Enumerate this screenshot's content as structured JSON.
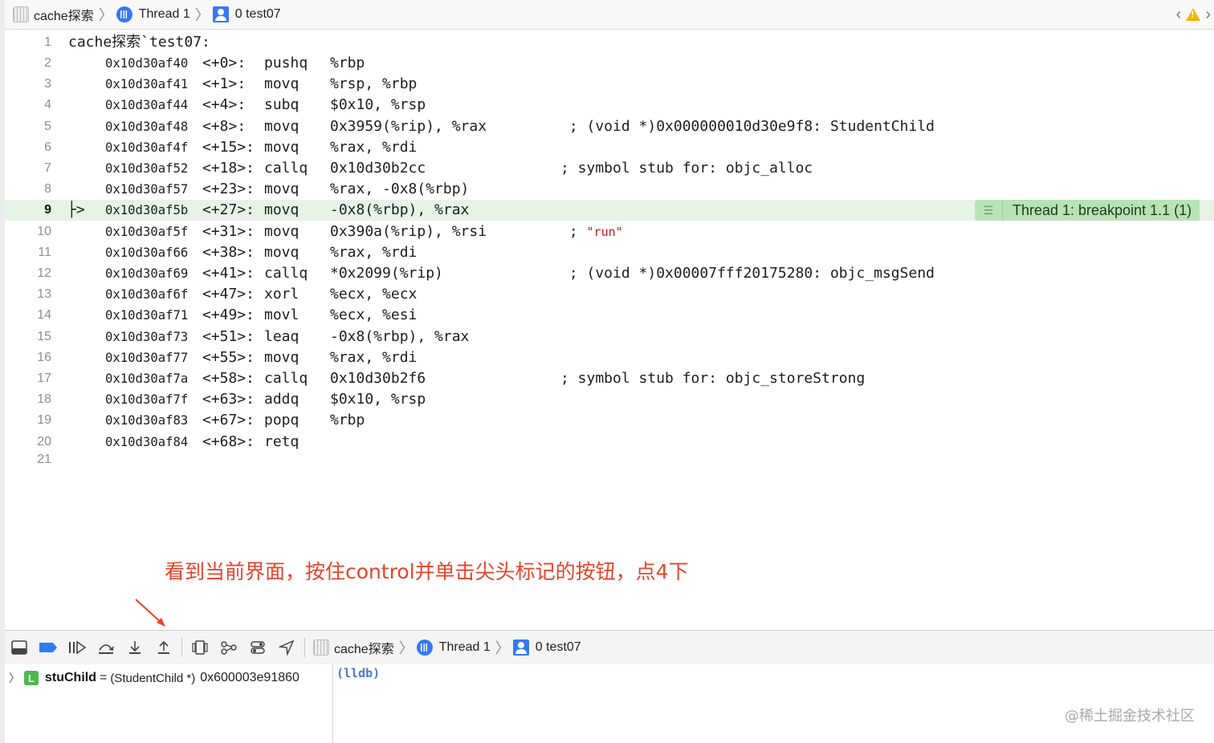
{
  "jump_bar": {
    "target": "cache探索",
    "thread": "Thread 1",
    "frame": "0 test07"
  },
  "editor": {
    "header": "cache探索`test07:",
    "pc_arrow": "├>",
    "current_line": 9,
    "breakpoint_label": "Thread 1: breakpoint 1.1 (1)",
    "lines": [
      {
        "n": "2",
        "addr": "0x10d30af40",
        "off": "<+0>:",
        "mn": "pushq",
        "op": "%rbp",
        "cm": ""
      },
      {
        "n": "3",
        "addr": "0x10d30af41",
        "off": "<+1>:",
        "mn": "movq",
        "op": "%rsp, %rbp",
        "cm": ""
      },
      {
        "n": "4",
        "addr": "0x10d30af44",
        "off": "<+4>:",
        "mn": "subq",
        "op": "$0x10, %rsp",
        "cm": ""
      },
      {
        "n": "5",
        "addr": "0x10d30af48",
        "off": "<+8>:",
        "mn": "movq",
        "op": "0x3959(%rip), %rax",
        "cm": " ; (void *)0x000000010d30e9f8: StudentChild"
      },
      {
        "n": "6",
        "addr": "0x10d30af4f",
        "off": "<+15>:",
        "mn": "movq",
        "op": "%rax, %rdi",
        "cm": ""
      },
      {
        "n": "7",
        "addr": "0x10d30af52",
        "off": "<+18>:",
        "mn": "callq",
        "op": "0x10d30b2cc",
        "cm": "; symbol stub for: objc_alloc"
      },
      {
        "n": "8",
        "addr": "0x10d30af57",
        "off": "<+23>:",
        "mn": "movq",
        "op": "%rax, -0x8(%rbp)",
        "cm": ""
      },
      {
        "n": "9",
        "addr": "0x10d30af5b",
        "off": "<+27>:",
        "mn": "movq",
        "op": "-0x8(%rbp), %rax",
        "cm": ""
      },
      {
        "n": "10",
        "addr": "0x10d30af5f",
        "off": "<+31>:",
        "mn": "movq",
        "op": "0x390a(%rip), %rsi",
        "cm": " ; ",
        "str": "\"run\""
      },
      {
        "n": "11",
        "addr": "0x10d30af66",
        "off": "<+38>:",
        "mn": "movq",
        "op": "%rax, %rdi",
        "cm": ""
      },
      {
        "n": "12",
        "addr": "0x10d30af69",
        "off": "<+41>:",
        "mn": "callq",
        "op": "*0x2099(%rip)",
        "cm": " ; (void *)0x00007fff20175280: objc_msgSend"
      },
      {
        "n": "13",
        "addr": "0x10d30af6f",
        "off": "<+47>:",
        "mn": "xorl",
        "op": "%ecx, %ecx",
        "cm": ""
      },
      {
        "n": "14",
        "addr": "0x10d30af71",
        "off": "<+49>:",
        "mn": "movl",
        "op": "%ecx, %esi",
        "cm": ""
      },
      {
        "n": "15",
        "addr": "0x10d30af73",
        "off": "<+51>:",
        "mn": "leaq",
        "op": "-0x8(%rbp), %rax",
        "cm": ""
      },
      {
        "n": "16",
        "addr": "0x10d30af77",
        "off": "<+55>:",
        "mn": "movq",
        "op": "%rax, %rdi",
        "cm": ""
      },
      {
        "n": "17",
        "addr": "0x10d30af7a",
        "off": "<+58>:",
        "mn": "callq",
        "op": "0x10d30b2f6",
        "cm": "; symbol stub for: objc_storeStrong"
      },
      {
        "n": "18",
        "addr": "0x10d30af7f",
        "off": "<+63>:",
        "mn": "addq",
        "op": "$0x10, %rsp",
        "cm": ""
      },
      {
        "n": "19",
        "addr": "0x10d30af83",
        "off": "<+67>:",
        "mn": "popq",
        "op": "%rbp",
        "cm": ""
      },
      {
        "n": "20",
        "addr": "0x10d30af84",
        "off": "<+68>:",
        "mn": "retq",
        "op": "",
        "cm": ""
      }
    ],
    "last_line": "21"
  },
  "annotation": "看到当前界面，按住control并单击尖头标记的按钮，点4下",
  "debug_bar": {
    "target": "cache探索",
    "thread": "Thread 1",
    "frame": "0 test07"
  },
  "variables": {
    "badge": "L",
    "name": "stuChild",
    "eq": "=",
    "type": "(StudentChild *)",
    "value": "0x600003e91860"
  },
  "console": {
    "prompt": "(lldb)"
  },
  "watermark": "@稀土掘金技术社区",
  "colors": {
    "accent": "#3478f6",
    "current_line_bg": "#e7f3e6",
    "breakpoint_badge": "#b9e3b5",
    "annotation": "#e8432a"
  }
}
